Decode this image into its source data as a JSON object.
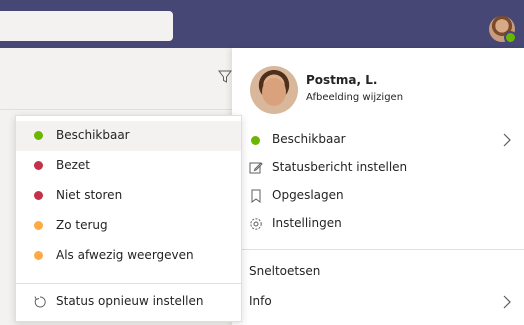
{
  "colors": {
    "header": "#464775",
    "available": "#6bb700",
    "busy": "#c4314b",
    "away": "#ffaa44"
  },
  "profile": {
    "name": "Postma, L.",
    "change_picture": "Afbeelding wijzigen",
    "status_label": "Beschikbaar"
  },
  "menu": {
    "status_message": "Statusbericht instellen",
    "saved": "Opgeslagen",
    "settings": "Instellingen",
    "shortcuts": "Sneltoetsen",
    "info": "Info"
  },
  "status_menu": {
    "items": [
      {
        "label": "Beschikbaar",
        "color": "#6bb700",
        "icon": "available-dot"
      },
      {
        "label": "Bezet",
        "color": "#c4314b",
        "icon": "busy-dot"
      },
      {
        "label": "Niet storen",
        "color": "#c4314b",
        "icon": "do-not-disturb-dot"
      },
      {
        "label": "Zo terug",
        "color": "#ffaa44",
        "icon": "be-right-back-dot"
      },
      {
        "label": "Als afwezig weergeven",
        "color": "#ffaa44",
        "icon": "away-dot"
      }
    ],
    "reset": "Status opnieuw instellen"
  }
}
